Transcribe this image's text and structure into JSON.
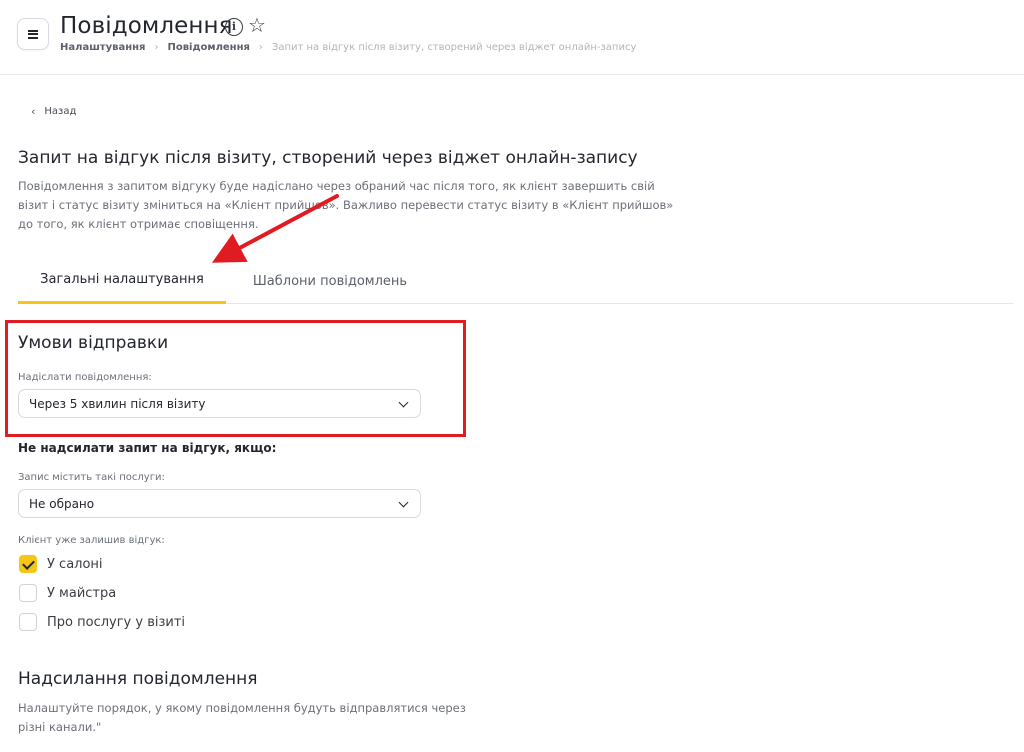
{
  "header": {
    "title": "Повідомлення",
    "info_icon": "i",
    "star_icon": "☆",
    "breadcrumb": [
      "Налаштування",
      "Повідомлення",
      "Запит на відгук після візиту, створений через віджет онлайн-запису"
    ]
  },
  "back": {
    "label": "Назад"
  },
  "section": {
    "title": "Запит на відгук після візиту, створений через віджет онлайн-запису",
    "description": "Повідомлення з запитом відгуку буде надіслано через обраний час після того, як клієнт завершить свій візит і статус візиту зміниться на «Клієнт прийшов». Важливо перевести статус візиту в «Клієнт прийшов» до того, як клієнт отримає сповіщення."
  },
  "tabs": [
    {
      "label": "Загальні налаштування",
      "active": true
    },
    {
      "label": "Шаблони повідомлень",
      "active": false
    }
  ],
  "conditions": {
    "title": "Умови відправки",
    "send_label": "Надіслати повідомлення:",
    "send_value": "Через 5 хвилин після візиту",
    "no_send_heading": "Не надсилати запит на відгук, якщо:",
    "services_label": "Запис містить такі послуги:",
    "services_value": "Не обрано",
    "left_review_label": "Клієнт уже залишив відгук:",
    "checkboxes": [
      {
        "label": "У салоні",
        "checked": true
      },
      {
        "label": "У майстра",
        "checked": false
      },
      {
        "label": "Про послугу у візиті",
        "checked": false
      }
    ]
  },
  "sending": {
    "title": "Надсилання повідомлення",
    "description": "Налаштуйте порядок, у якому повідомлення будуть відправлятися через різні канали.\""
  },
  "colors": {
    "accent": "#f5c518",
    "annotation": "#e11b22",
    "text": "#23262f",
    "muted": "#6b6f79"
  }
}
